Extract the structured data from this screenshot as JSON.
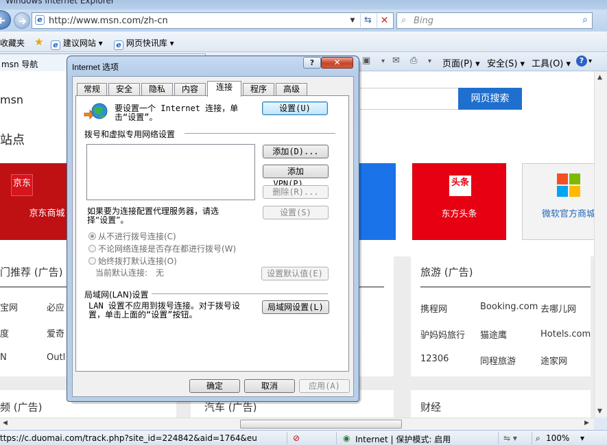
{
  "browser": {
    "title": "Windows Internet Explorer",
    "address": "http://www.msn.com/zh-cn",
    "search_placeholder": "Bing",
    "favorites": {
      "label": "收藏夹",
      "suggested_sites": "建议网站",
      "web_slices": "网页快讯库"
    },
    "tab_label": "msn 导航",
    "commands": {
      "page": "页面(P)",
      "safety": "安全(S)",
      "tools": "工具(O)"
    }
  },
  "page": {
    "logo": "msn",
    "search_button": "网页搜索",
    "sites_title": "站点",
    "tiles": [
      {
        "label": "京东商城",
        "logo": "京东"
      },
      {
        "label": "东方头条",
        "logo": "头条"
      },
      {
        "label": "微软官方商城"
      }
    ],
    "sections": {
      "hot": {
        "title": "门推荐 (广告)",
        "links": [
          "宝网",
          "必应",
          "度",
          "爱奇",
          "N",
          "Outl"
        ]
      },
      "travel": {
        "title": "旅游 (广告)",
        "links": [
          "携程网",
          "Booking.com",
          "去哪儿网",
          "驴妈妈旅行",
          "猫途鹰",
          "Hotels.com",
          "12306",
          "同程旅游",
          "途家网"
        ]
      },
      "video": {
        "title": "频 (广告)"
      },
      "car": {
        "title": "汽车 (广告)"
      },
      "finance": {
        "title": "财经"
      }
    }
  },
  "status": {
    "url": "ttps://c.duomai.com/track.php?site_id=224842&aid=1764&eu",
    "zone": "Internet | 保护模式: 启用",
    "zoom": "100%"
  },
  "dialog": {
    "title": "Internet 选项",
    "help": "?",
    "close": "✕",
    "tabs": [
      "常规",
      "安全",
      "隐私",
      "内容",
      "连接",
      "程序",
      "高级"
    ],
    "active_tab": "连接",
    "setup_text": "要设置一个 Internet 连接，单击“设置”。",
    "setup_button": "设置(U)",
    "dialup_group": "拨号和虚拟专用网络设置",
    "add_button": "添加(D)...",
    "add_vpn_button": "添加 VPN(P)...",
    "remove_button": "删除(R)...",
    "proxy_text": "如果要为连接配置代理服务器，请选择“设置”。",
    "settings_button": "设置(S)",
    "radios": [
      "从不进行拨号连接(C)",
      "不论网络连接是否存在都进行拨号(W)",
      "始终拨打默认连接(O)"
    ],
    "radio_selected": 0,
    "default_label": "当前默认连接:",
    "default_value": "无",
    "set_default_button": "设置默认值(E)",
    "lan_group": "局域网(LAN)设置",
    "lan_text": "LAN 设置不应用到拨号连接。对于拨号设置，单击上面的“设置”按钮。",
    "lan_button": "局域网设置(L)",
    "ok_button": "确定",
    "cancel_button": "取消",
    "apply_button": "应用(A)"
  }
}
